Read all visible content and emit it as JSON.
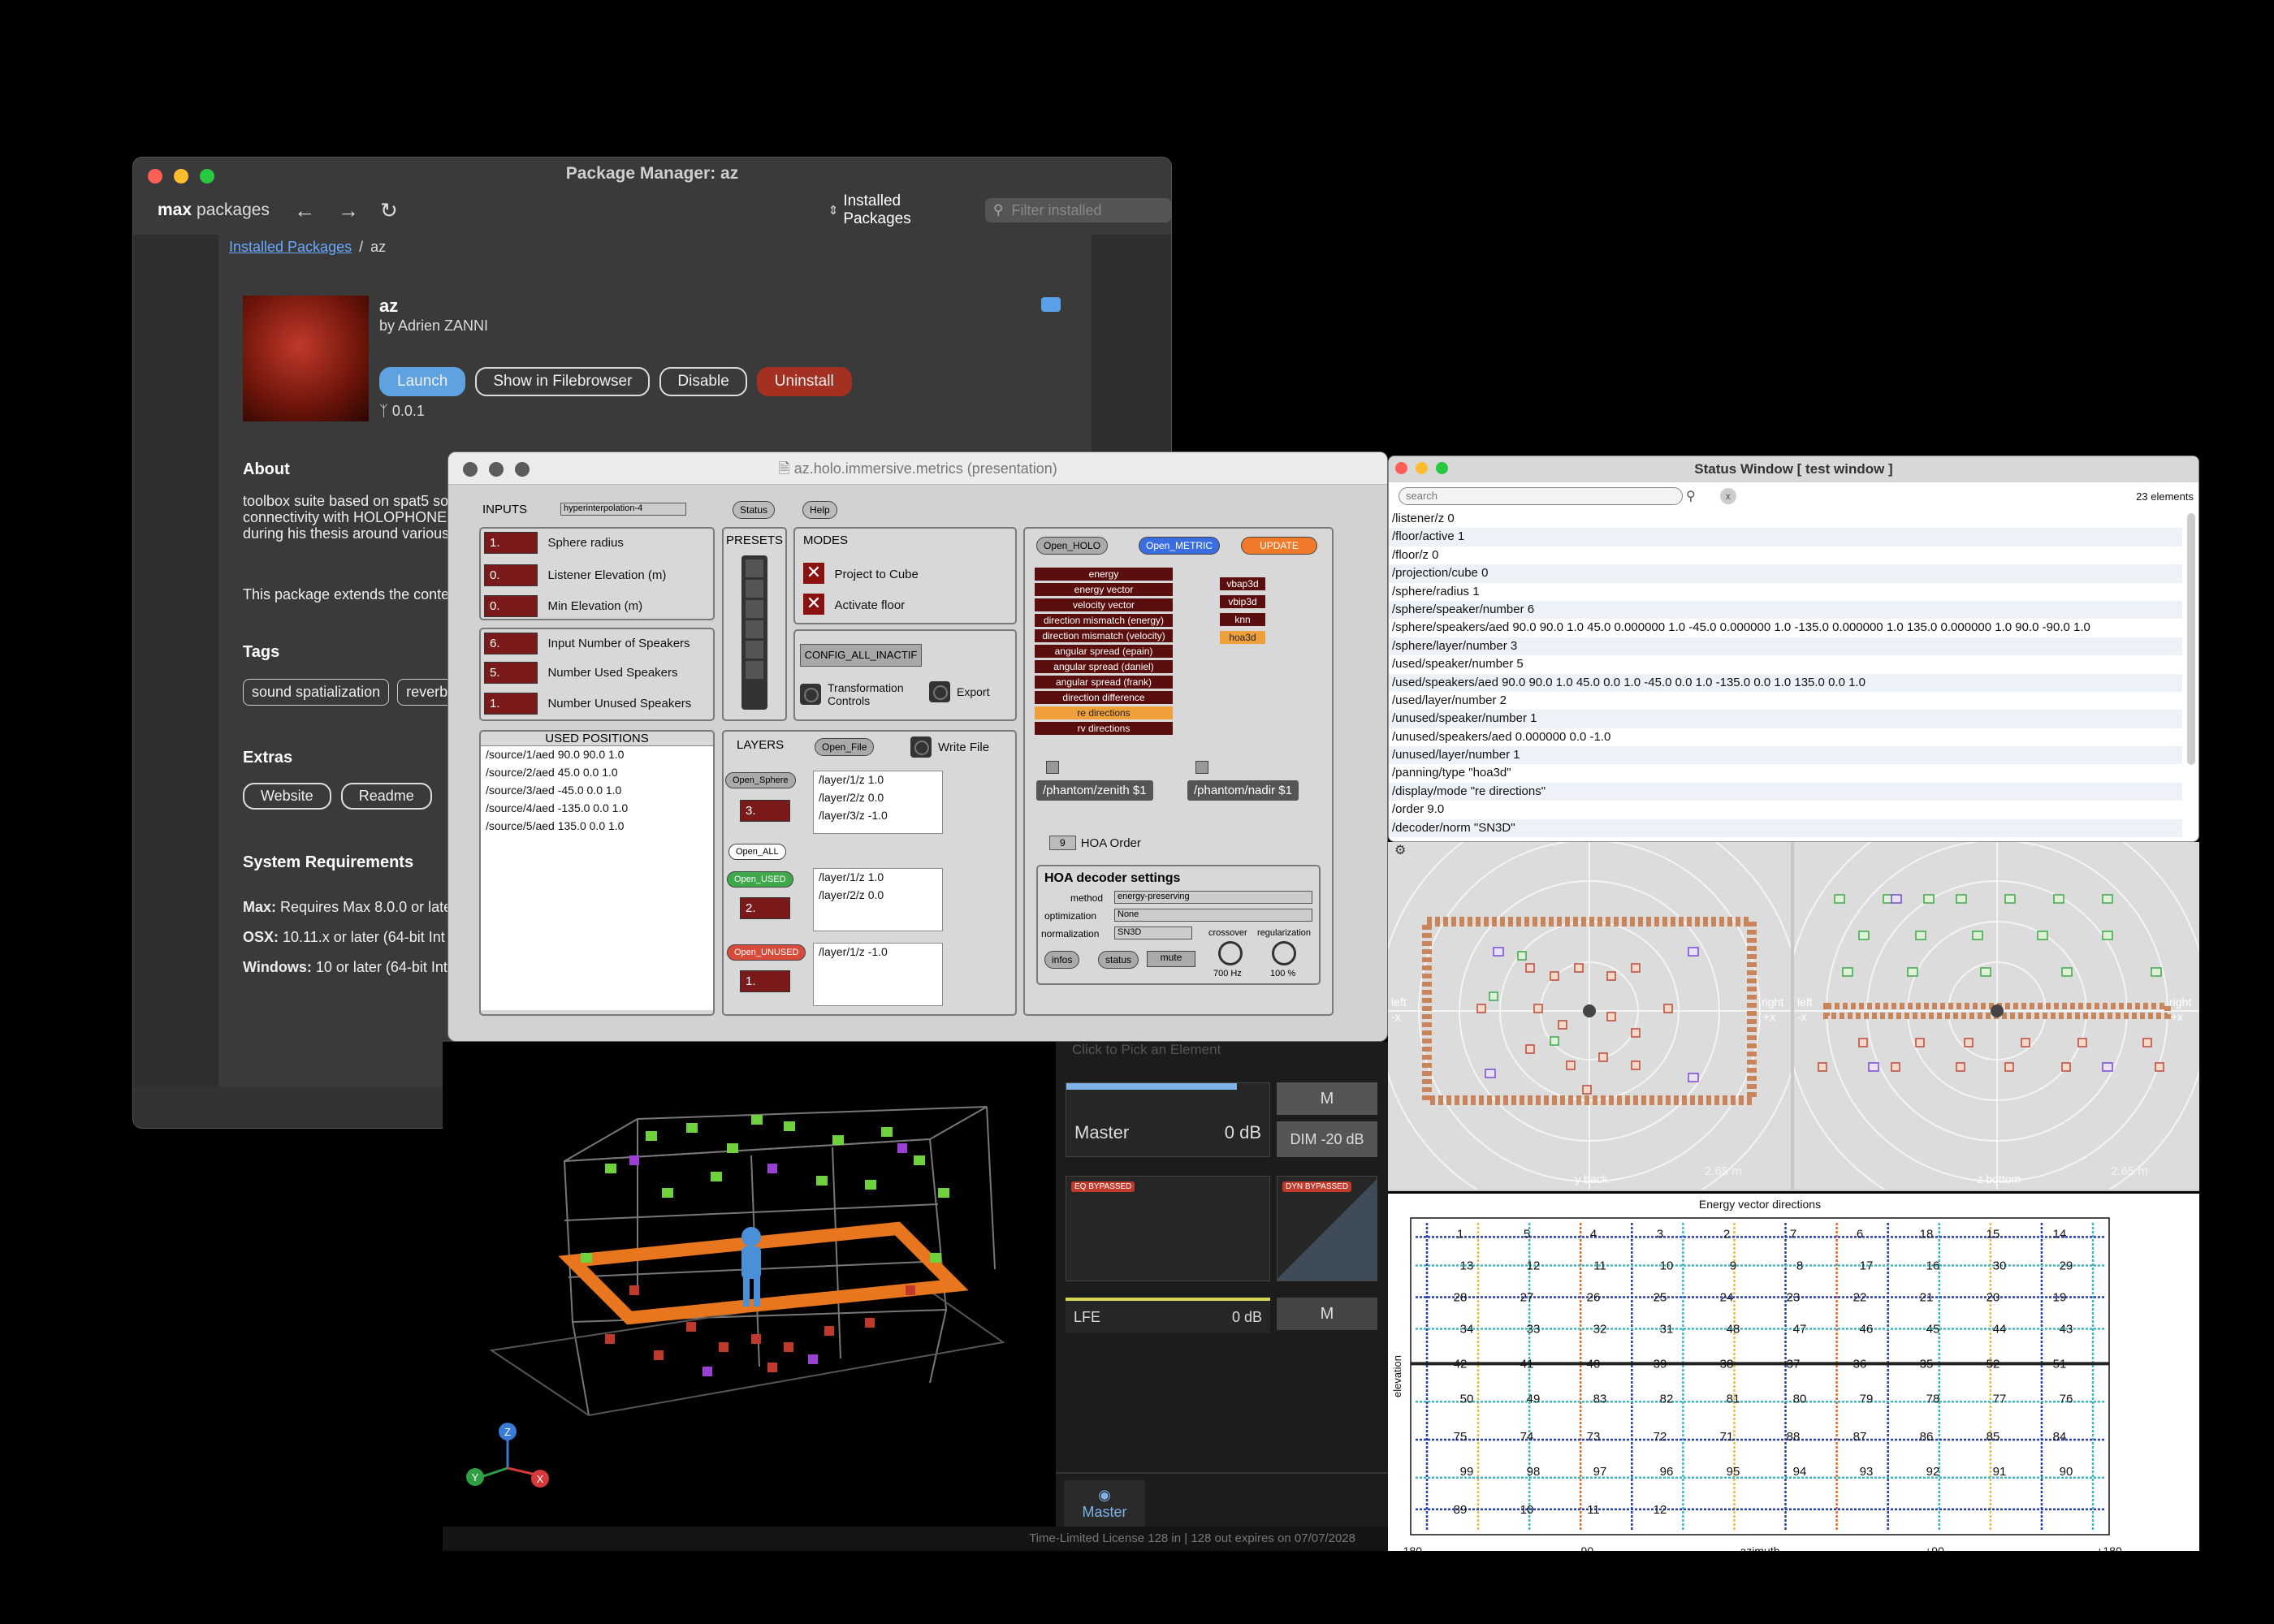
{
  "package_manager": {
    "window_title": "Package Manager: az",
    "app_bold": "max",
    "app_light": "packages",
    "sort_label": "Installed Packages",
    "filter_placeholder": "Filter installed",
    "breadcrumb_link": "Installed Packages",
    "breadcrumb_sep": "/",
    "breadcrumb_current": "az",
    "package_name": "az",
    "author": "by Adrien ZANNI",
    "buttons": {
      "launch": "Launch",
      "show": "Show in Filebrowser",
      "disable": "Disable",
      "uninstall": "Uninstall"
    },
    "version": "0.0.1",
    "about_heading": "About",
    "about_lines": [
      "toolbox suite based on spat5 so",
      "connectivity with HOLOPHONE",
      "during his thesis around various"
    ],
    "about_line2": "This package extends the conte",
    "tags_heading": "Tags",
    "tags": [
      "sound spatialization",
      "reverb"
    ],
    "extras_heading": "Extras",
    "extras": [
      "Website",
      "Readme"
    ],
    "sysreq_heading": "System Requirements",
    "sysreq": [
      {
        "k": "Max:",
        "v": "Requires Max 8.0.0 or late"
      },
      {
        "k": "OSX:",
        "v": "10.11.x or later (64-bit Int"
      },
      {
        "k": "Windows:",
        "v": "10 or later (64-bit Int"
      }
    ]
  },
  "patch": {
    "window_title": "az.holo.immersive.metrics (presentation)",
    "inputs_label": "INPUTS",
    "interp": "hyperinterpolation-4",
    "status_btn": "Status",
    "help_btn": "Help",
    "inputs": [
      {
        "v": "1.",
        "l": "Sphere radius"
      },
      {
        "v": "0.",
        "l": "Listener Elevation (m)"
      },
      {
        "v": "0.",
        "l": "Min Elevation (m)"
      }
    ],
    "speakers": [
      {
        "v": "6.",
        "l": "Input Number of Speakers"
      },
      {
        "v": "5.",
        "l": "Number Used Speakers"
      },
      {
        "v": "1.",
        "l": "Number Unused Speakers"
      }
    ],
    "presets_label": "PRESETS",
    "modes_label": "MODES",
    "mode_project": "Project to Cube",
    "mode_floor": "Activate floor",
    "config_btn": "CONFIG_ALL_INACTIF",
    "transform": "Transformation Controls",
    "export": "Export",
    "used_positions_label": "USED POSITIONS",
    "used_positions": [
      "/source/1/aed 90.0 90.0 1.0",
      "/source/2/aed 45.0 0.0 1.0",
      "/source/3/aed -45.0 0.0 1.0",
      "/source/4/aed -135.0 0.0 1.0",
      "/source/5/aed 135.0 0.0 1.0"
    ],
    "layers_label": "LAYERS",
    "open_file": "Open_File",
    "write_file": "Write File",
    "open_sphere": "Open_Sphere",
    "sphere_num": "3.",
    "sphere_layers": [
      "/layer/1/z 1.0",
      "/layer/2/z 0.0",
      "/layer/3/z -1.0"
    ],
    "open_all": "Open_ALL",
    "open_used": "Open_USED",
    "used_num": "2.",
    "used_layers": [
      "/layer/1/z 1.0",
      "/layer/2/z 0.0"
    ],
    "open_unused": "Open_UNUSED",
    "unused_num": "1.",
    "unused_layers": [
      "/layer/1/z -1.0"
    ],
    "open_holo": "Open_HOLO",
    "open_metric": "Open_METRIC",
    "update": "UPDATE",
    "metrics": [
      "energy",
      "energy vector",
      "velocity vector",
      "direction mismatch (energy)",
      "direction mismatch (velocity)",
      "angular spread (epain)",
      "angular spread (daniel)",
      "angular spread (frank)",
      "direction difference",
      "re directions",
      "rv directions"
    ],
    "metrics_selected": "re directions",
    "panning": [
      "vbap3d",
      "vbip3d",
      "knn",
      "hoa3d"
    ],
    "panning_selected": "hoa3d",
    "zenith": "/phantom/zenith $1",
    "nadir": "/phantom/nadir $1",
    "hoa_order_val": "9",
    "hoa_order_label": "HOA Order",
    "decoder_title": "HOA decoder settings",
    "method_label": "method",
    "method_val": "energy-preserving",
    "optim_label": "optimization",
    "optim_val": "None",
    "norm_label": "normalization",
    "norm_val": "SN3D",
    "crossover_label": "crossover",
    "crossover_val": "700 Hz",
    "reg_label": "regularization",
    "reg_val": "100 %",
    "infos_btn": "infos",
    "status_btn2": "status",
    "mute_btn": "mute"
  },
  "status_window": {
    "title": "Status Window [  test window ]",
    "search_placeholder": "search",
    "count": "23 elements",
    "rows": [
      "/listener/z 0",
      "/floor/active 1",
      "/floor/z 0",
      "/projection/cube 0",
      "/sphere/radius 1",
      "/sphere/speaker/number 6",
      "/sphere/speakers/aed 90.0 90.0 1.0 45.0 0.000000 1.0 -45.0 0.000000 1.0 -135.0 0.000000 1.0 135.0 0.000000 1.0 90.0 -90.0 1.0",
      "/sphere/layer/number 3",
      "/used/speaker/number 5",
      "/used/speakers/aed 90.0 90.0 1.0 45.0 0.0 1.0 -45.0 0.0 1.0 -135.0 0.0 1.0 135.0 0.0 1.0",
      "/used/layer/number 2",
      "/unused/speaker/number 1",
      "/unused/speakers/aed 0.000000 0.0 -1.0",
      "/unused/layer/number 1",
      "/panning/type \"hoa3d\"",
      "/display/mode \"re directions\"",
      "/order 9.0",
      "/decoder/norm \"SN3D\""
    ]
  },
  "viewer": {
    "left_label": "left",
    "right_label": "right",
    "plus_x": "+x",
    "minus_x": "-x",
    "back": "-y back",
    "bottom": "-z bottom",
    "scale": "2.65 m"
  },
  "mixer": {
    "master_label": "Master",
    "master_db": "0 dB",
    "mute": "M",
    "dim": "DIM -20 dB",
    "eq": "EQ BYPASSED",
    "dyn": "DYN BYPASSED",
    "lfe_label": "LFE",
    "lfe_db": "0 dB",
    "master_tab": "Master",
    "faint": "Click to Pick an Element"
  },
  "footer": "Time-Limited License 128 in | 128 out expires on 07/07/2028",
  "axis_z": "Z",
  "axis_y": "Y",
  "axis_x": "X",
  "chart_data": {
    "type": "scatter",
    "title": "Energy vector directions",
    "xlabel": "azimuth",
    "ylabel": "elevation",
    "x_ticks": [
      "-180",
      "-90",
      "azimuth",
      "+90",
      "+180"
    ],
    "labels": [
      "1",
      "5",
      "4",
      "3",
      "2",
      "7",
      "6",
      "18",
      "15",
      "14",
      "13",
      "12",
      "11",
      "10",
      "9",
      "8",
      "17",
      "16",
      "30",
      "29",
      "28",
      "27",
      "26",
      "25",
      "24",
      "23",
      "22",
      "21",
      "20",
      "19",
      "34",
      "33",
      "32",
      "31",
      "48",
      "47",
      "46",
      "45",
      "44",
      "43",
      "42",
      "41",
      "40",
      "39",
      "38",
      "37",
      "36",
      "35",
      "52",
      "51",
      "50",
      "49",
      "83",
      "82",
      "81",
      "80",
      "79",
      "78",
      "77",
      "76",
      "75",
      "74",
      "73",
      "72",
      "71",
      "88",
      "87",
      "86",
      "85",
      "84",
      "99",
      "98",
      "97",
      "96",
      "95",
      "94",
      "93",
      "92",
      "91",
      "90",
      "89",
      "10",
      "11",
      "12"
    ]
  }
}
